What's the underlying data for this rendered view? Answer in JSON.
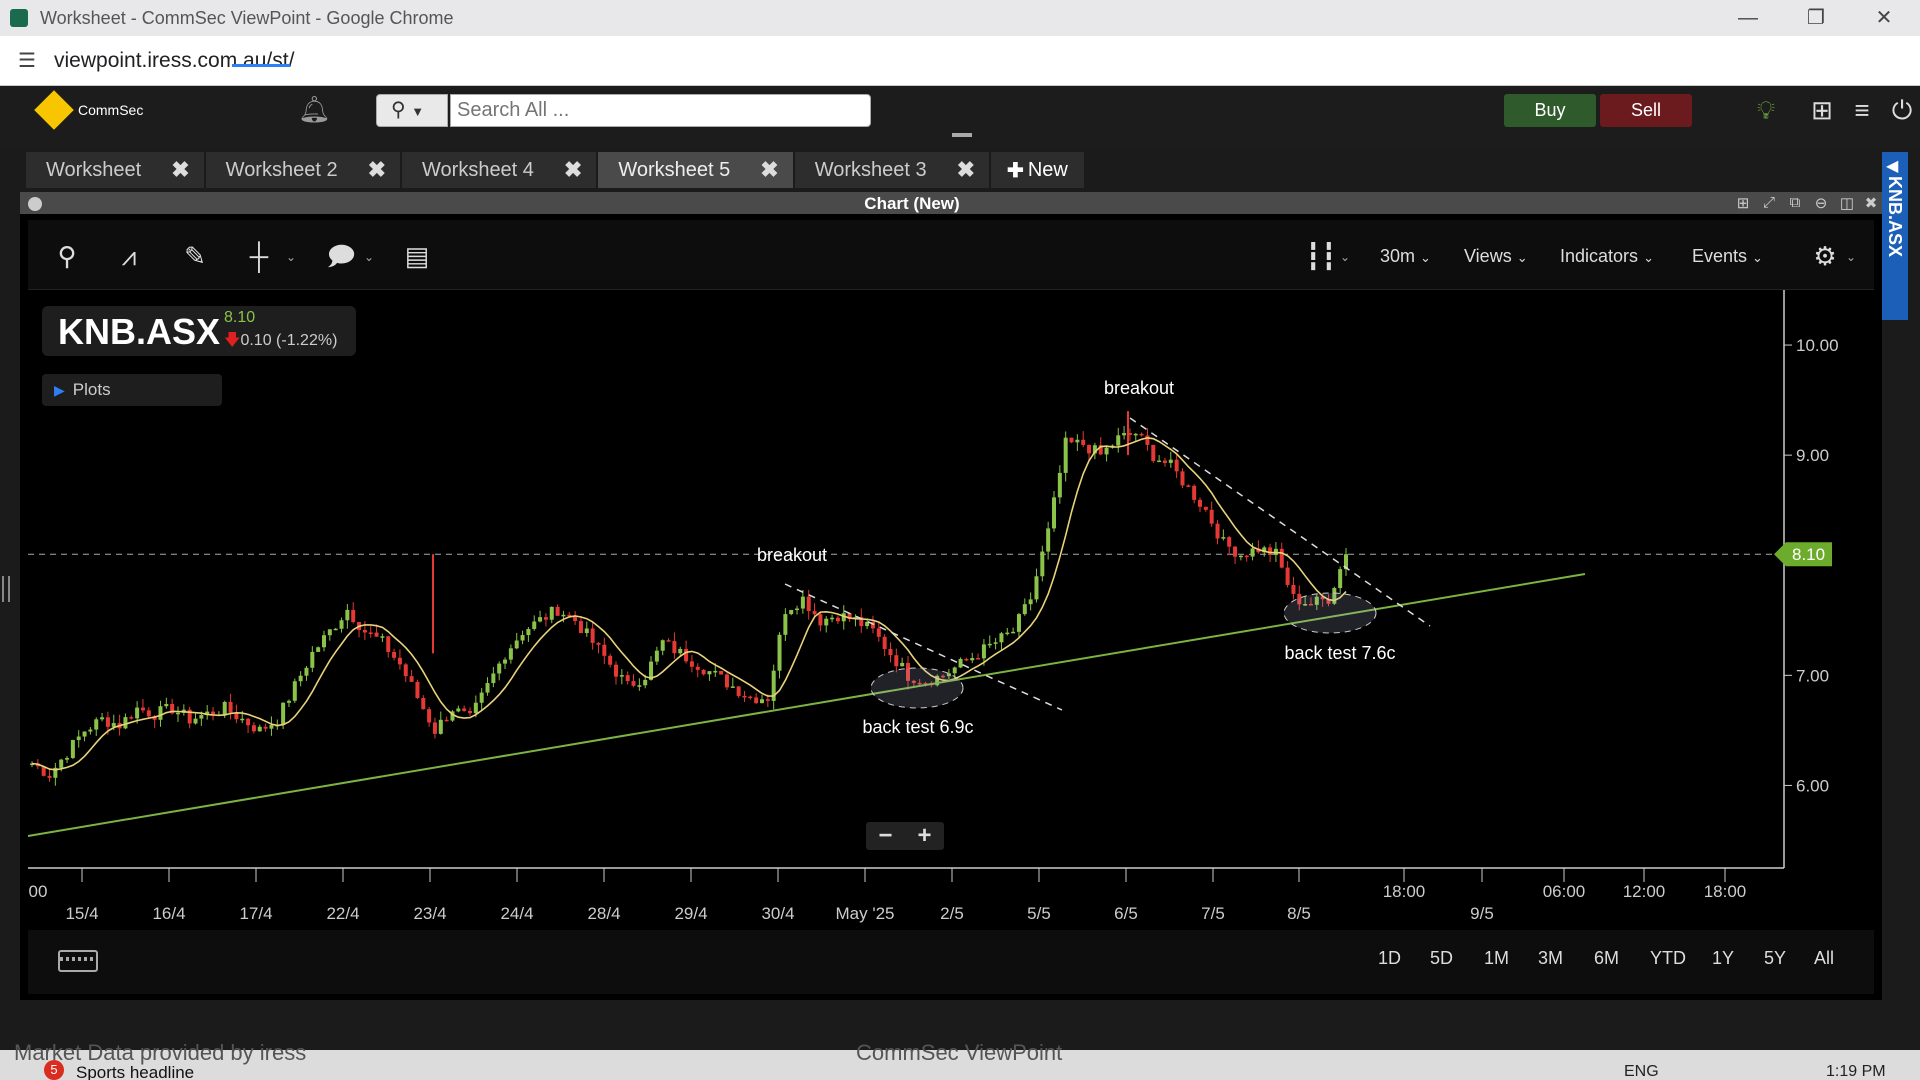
{
  "window": {
    "title": "Worksheet - CommSec ViewPoint - Google Chrome",
    "minimize_icon": "minimize-icon",
    "restore_icon": "restore-icon",
    "close_icon": "close-icon"
  },
  "address_bar": {
    "url": "viewpoint.iress.com.au/st/"
  },
  "header": {
    "brand": "CommSec",
    "search_placeholder": "Search All ...",
    "buy_label": "Buy",
    "sell_label": "Sell",
    "buy_color": "#2f5a2c",
    "sell_color": "#6b1a1e"
  },
  "tabs": [
    {
      "label": "Worksheet",
      "active": false
    },
    {
      "label": "Worksheet 2",
      "active": false
    },
    {
      "label": "Worksheet 4",
      "active": false
    },
    {
      "label": "Worksheet 5",
      "active": true
    },
    {
      "label": "Worksheet 3",
      "active": false
    }
  ],
  "new_tab_label": "New",
  "chart_window": {
    "title": "Chart (New)",
    "side_label": "KNB.ASX"
  },
  "toolbar": {
    "interval": "30m",
    "views": "Views",
    "indicators": "Indicators",
    "events": "Events"
  },
  "symbol": {
    "code": "KNB.ASX",
    "price": "8.10",
    "change": "0.10 (-1.22%)"
  },
  "plots_label": "Plots",
  "range_buttons": [
    "1D",
    "5D",
    "1M",
    "3M",
    "6M",
    "YTD",
    "1Y",
    "5Y",
    "All"
  ],
  "footer": {
    "market_data": "Market Data provided by iress",
    "app_name": "CommSec ViewPoint",
    "news": "Sports headline",
    "news_count": "5",
    "lang": "ENG",
    "time": "1:19 PM"
  },
  "chart_data": {
    "type": "candlestick",
    "y_ticks": [
      "10.00",
      "9.00",
      "8.10",
      "7.00",
      "6.00"
    ],
    "y_tick_values": [
      10.0,
      9.0,
      8.1,
      7.0,
      6.0
    ],
    "ylim": [
      5.25,
      10.5
    ],
    "last_price_label": "8.10",
    "last_price": 8.1,
    "x_labels_row1": [
      "00",
      "18:00",
      "06:00",
      "12:00",
      "18:00"
    ],
    "x_labels_row2": [
      "15/4",
      "16/4",
      "17/4",
      "22/4",
      "23/4",
      "24/4",
      "28/4",
      "29/4",
      "30/4",
      "May '25",
      "2/5",
      "5/5",
      "6/5",
      "7/5",
      "8/5",
      "9/5"
    ],
    "annotations": [
      {
        "text": "breakout"
      },
      {
        "text": "breakout"
      },
      {
        "text": "back test 6.9c"
      },
      {
        "text": "back test 7.6c"
      }
    ],
    "series": [
      {
        "type": "candles",
        "up_color": "#8bc34a",
        "down_color": "#e53935"
      },
      {
        "type": "moving-average",
        "color": "#e8d37a"
      },
      {
        "type": "trendline-support",
        "color": "#7cb342"
      }
    ],
    "close_path": [
      6.2,
      6.1,
      6.3,
      6.5,
      6.6,
      6.55,
      6.7,
      6.65,
      6.7,
      6.6,
      6.65,
      6.7,
      6.6,
      6.5,
      6.6,
      6.9,
      7.2,
      7.4,
      7.6,
      7.4,
      7.3,
      7.1,
      6.8,
      6.5,
      6.7,
      6.6,
      6.9,
      7.2,
      7.4,
      7.5,
      7.6,
      7.5,
      7.3,
      7.1,
      6.9,
      7.0,
      7.3,
      7.2,
      7.1,
      7.0,
      6.9,
      6.8,
      6.8,
      7.6,
      7.7,
      7.5,
      7.55,
      7.5,
      7.4,
      7.2,
      7.0,
      6.95,
      7.0,
      7.1,
      7.2,
      7.3,
      7.4,
      7.7,
      8.3,
      9.1,
      9.1,
      9.0,
      9.15,
      9.2,
      9.0,
      8.9,
      8.7,
      8.5,
      8.2,
      8.1,
      8.15,
      8.1,
      7.7,
      7.65,
      7.7,
      8.1
    ]
  }
}
